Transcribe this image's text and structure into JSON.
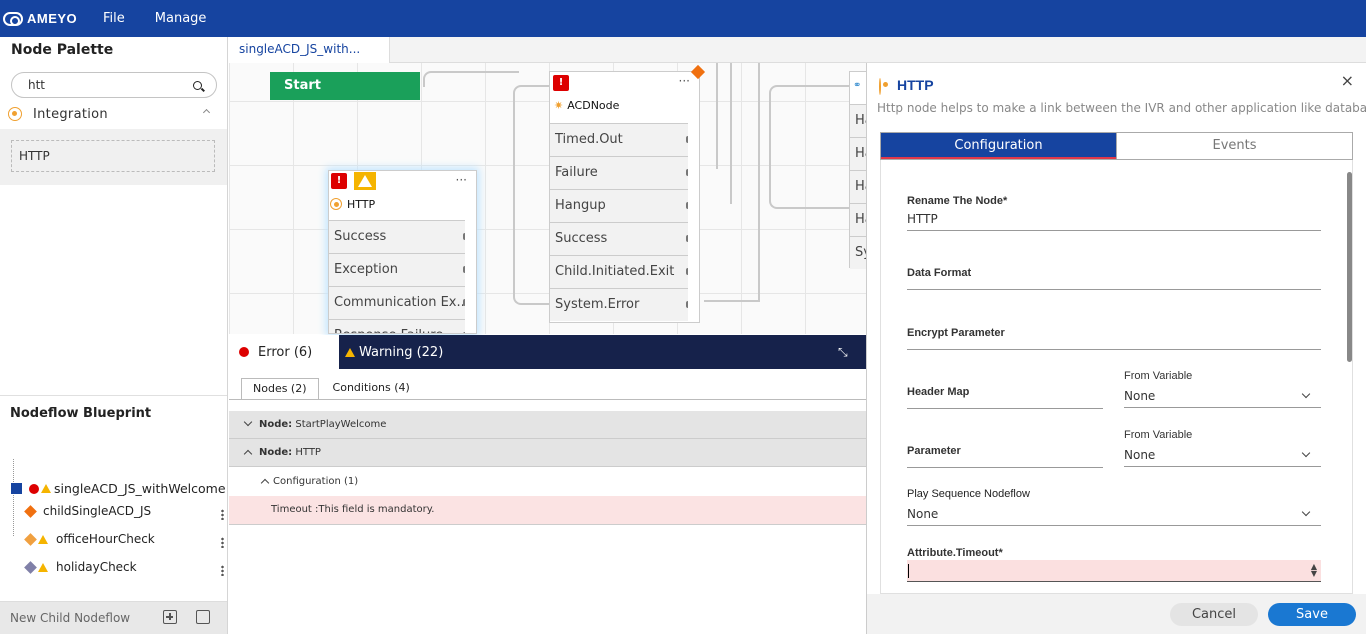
{
  "app": {
    "logo_text": "AMEYO",
    "menu": [
      "File",
      "Manage"
    ]
  },
  "palette": {
    "title": "Node Palette",
    "search": {
      "value": "htt"
    },
    "category": "Integration",
    "items": [
      "HTTP"
    ]
  },
  "blueprint": {
    "title": "Nodeflow Blueprint",
    "root": "singleACD_JS_withWelcome",
    "children": [
      "childSingleACD_JS",
      "officeHourCheck",
      "holidayCheck"
    ],
    "footer_label": "New Child Nodeflow"
  },
  "editor": {
    "tab": "singleACD_JS_with..."
  },
  "canvas": {
    "start_label": "Start",
    "acd_node": {
      "title": "ACDNode",
      "ports": [
        "Timed.Out",
        "Failure",
        "Hangup",
        "Success",
        "Child.Initiated.Exit",
        "System.Error"
      ]
    },
    "http_node": {
      "title": "HTTP",
      "ports": [
        "Success",
        "Exception",
        "Communication Ex...",
        "Response Failure"
      ]
    },
    "partial_ports": [
      "Ha",
      "Ha",
      "Ha",
      "Ha",
      "Sy"
    ]
  },
  "validation": {
    "error_tab": "Error (6)",
    "warning_tab": "Warning (22)",
    "subtabs": [
      "Nodes (2)",
      "Conditions (4)"
    ],
    "rows": [
      {
        "label": "Node:",
        "value": "StartPlayWelcome"
      },
      {
        "label": "Node:",
        "value": "HTTP"
      }
    ],
    "config_label": "Configuration (1)",
    "message": "Timeout :This field is mandatory."
  },
  "properties": {
    "title": "HTTP",
    "close": "×",
    "description": "Http node helps to make a link between the IVR and other application like database",
    "tabs": [
      "Configuration",
      "Events"
    ],
    "fields": {
      "rename_label": "Rename The Node*",
      "rename_value": "HTTP",
      "data_format_label": "Data Format",
      "encrypt_label": "Encrypt Parameter",
      "header_map_label": "Header Map",
      "from_variable_label": "From Variable",
      "header_from_value": "None",
      "parameter_label": "Parameter",
      "parameter_from_value": "None",
      "play_seq_label": "Play Sequence Nodeflow",
      "play_seq_value": "None",
      "timeout_label": "Attribute.Timeout*"
    },
    "cancel": "Cancel",
    "save": "Save"
  },
  "colors": {
    "brand": "#1644a0",
    "start": "#1aa05a",
    "error": "#dd0000",
    "warning": "#f5b400",
    "save": "#1a78d2"
  }
}
